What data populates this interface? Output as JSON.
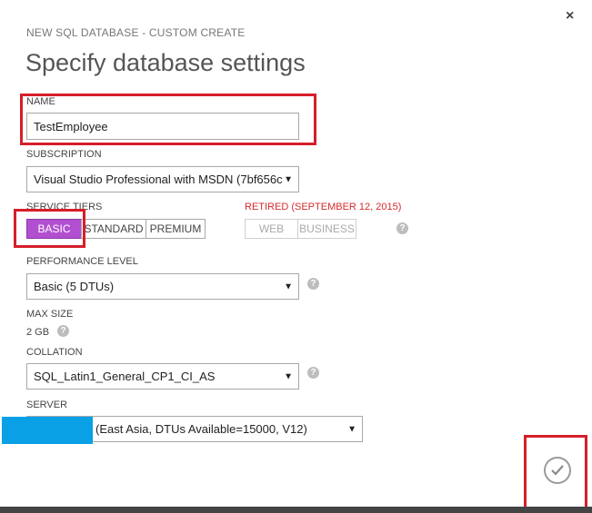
{
  "dialog": {
    "subtitle": "NEW SQL DATABASE - CUSTOM CREATE",
    "title": "Specify database settings",
    "close_icon": "×"
  },
  "name": {
    "label": "NAME",
    "value": "TestEmployee"
  },
  "subscription": {
    "label": "SUBSCRIPTION",
    "value": "Visual Studio Professional with MSDN (7bf656c"
  },
  "service_tiers": {
    "label": "SERVICE TIERS",
    "tiers": [
      "BASIC",
      "STANDARD",
      "PREMIUM"
    ],
    "selected": "BASIC",
    "retired_label": "RETIRED (SEPTEMBER 12, 2015)",
    "retired_tiers": [
      "WEB",
      "BUSINESS"
    ],
    "accent_color": "#b24fd0"
  },
  "performance": {
    "label": "PERFORMANCE LEVEL",
    "value": "Basic (5 DTUs)"
  },
  "max_size": {
    "label": "MAX SIZE",
    "value": "2 GB"
  },
  "collation": {
    "label": "COLLATION",
    "value": "SQL_Latin1_General_CP1_CI_AS"
  },
  "server": {
    "label": "SERVER",
    "value": "(East Asia, DTUs Available=15000, V12)",
    "redaction_color": "#0aa0e6"
  },
  "icons": {
    "dropdown": "▼",
    "help": "?",
    "confirm": "check-icon"
  },
  "highlight_color": "#d51f2a"
}
